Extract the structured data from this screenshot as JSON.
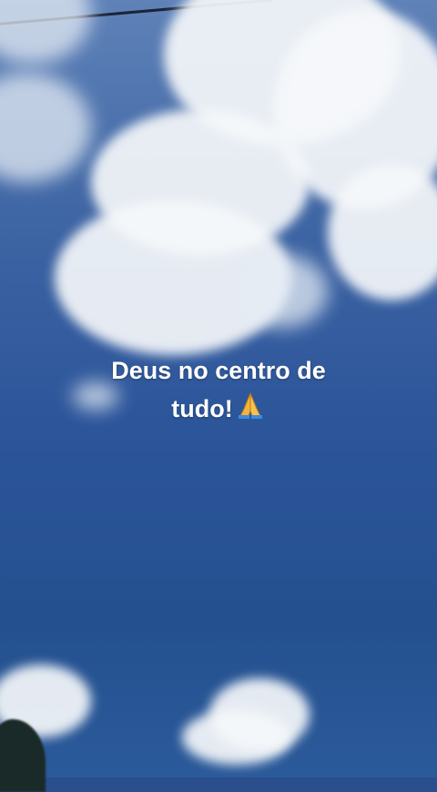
{
  "caption": {
    "line1": "Deus no centro de",
    "line2": "tudo!"
  },
  "icons": {
    "emoji": "folded-hands-icon"
  },
  "colors": {
    "sky": "#2c559a",
    "cloud": "#f5f7fa",
    "text": "#ffffff"
  }
}
